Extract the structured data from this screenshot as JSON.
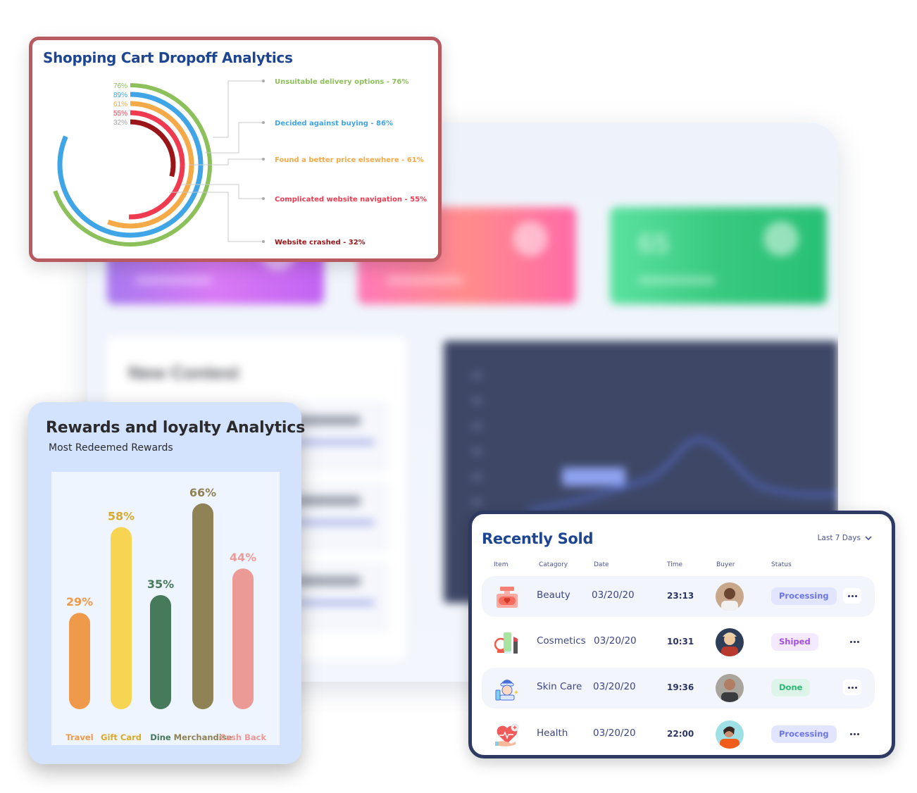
{
  "background_dashboard": {
    "stat_tile_value": "65",
    "contest_title": "New Contest"
  },
  "cart_card": {
    "title": "Shopping Cart Dropoff Analytics",
    "border_color": "#b85b61",
    "title_color": "#1d4591"
  },
  "rewards_card": {
    "title": "Rewards and loyalty Analytics",
    "subtitle": "Most Redeemed Rewards",
    "background_color": "#d3e3fd"
  },
  "sold_card": {
    "title": "Recently Sold",
    "range_selector": {
      "label": "Last 7 Days",
      "icon": "chevron-down-icon"
    },
    "columns": [
      "Item",
      "Catagory",
      "Date",
      "Time",
      "Buyer",
      "Status"
    ],
    "rows": [
      {
        "icon": "perfume-icon",
        "category": "Beauty",
        "date": "03/20/20",
        "time": "23:13",
        "buyer": "buyer-avatar-1",
        "status": "Processing",
        "status_type": "processing",
        "menu_icon": "more-horizontal-icon"
      },
      {
        "icon": "cosmetics-icon",
        "category": "Cosmetics",
        "date": "03/20/20",
        "time": "10:31",
        "buyer": "buyer-avatar-2",
        "status": "Shiped",
        "status_type": "shipped",
        "menu_icon": "more-horizontal-icon"
      },
      {
        "icon": "skin-care-icon",
        "category": "Skin Care",
        "date": "03/20/20",
        "time": "19:36",
        "buyer": "buyer-avatar-3",
        "status": "Done",
        "status_type": "done",
        "menu_icon": "more-horizontal-icon"
      },
      {
        "icon": "health-icon",
        "category": "Health",
        "date": "03/20/20",
        "time": "22:00",
        "buyer": "buyer-avatar-4",
        "status": "Processing",
        "status_type": "processing",
        "menu_icon": "more-horizontal-icon"
      }
    ],
    "status_colors": {
      "processing": {
        "bg": "#e2e5ff",
        "fg": "#6b74ea"
      },
      "shipped": {
        "bg": "#f4e9fe",
        "fg": "#a34fe6"
      },
      "done": {
        "bg": "#dcf5e8",
        "fg": "#2fb877"
      }
    }
  },
  "chart_data": [
    {
      "type": "radial-bar",
      "title": "Shopping Cart Dropoff Analytics",
      "ring_labels": [
        "76%",
        "89%",
        "61%",
        "55%",
        "32%"
      ],
      "series": [
        {
          "name": "Unsuitable delivery options",
          "value": 76,
          "legend": "Unsuitable delivery options - 76%",
          "color": "#8bc05a"
        },
        {
          "name": "Decided against buying",
          "value": 89,
          "legend": "Decided against buying - 86%",
          "color": "#3fa5e6"
        },
        {
          "name": "Found a better price elsewhere",
          "value": 61,
          "legend": "Found a better price elsewhere - 61%",
          "color": "#f5a947"
        },
        {
          "name": "Complicated website navigation",
          "value": 55,
          "legend": "Complicated website navigation - 55%",
          "color": "#ef3a4f"
        },
        {
          "name": "Website crashed",
          "value": 32,
          "legend": "Website crashed - 32%",
          "color": "#9a1518"
        }
      ],
      "ring_label_colors": [
        "#8bc05a",
        "#3fa5e6",
        "#f5a947",
        "#ef3a4f",
        "#a0a0a0"
      ],
      "legend_placement": "right",
      "range": [
        0,
        100
      ]
    },
    {
      "type": "bar",
      "title": "Rewards and loyalty Analytics",
      "subtitle": "Most Redeemed Rewards",
      "categories": [
        "Travel",
        "Gift Card",
        "Dine",
        "Merchandise",
        "Cash Back"
      ],
      "values": [
        29,
        58,
        35,
        66,
        44
      ],
      "data_labels": [
        "29%",
        "58%",
        "35%",
        "66%",
        "44%"
      ],
      "colors": [
        "#ef9a4a",
        "#f7d452",
        "#467a5a",
        "#8f8255",
        "#ec9a96"
      ],
      "label_colors": [
        "#ef9a4a",
        "#d8aa2c",
        "#467a5a",
        "#8f8255",
        "#ec9a96"
      ],
      "xlabel": "",
      "ylabel": "",
      "ylim": [
        0,
        70
      ],
      "grid": false
    }
  ]
}
